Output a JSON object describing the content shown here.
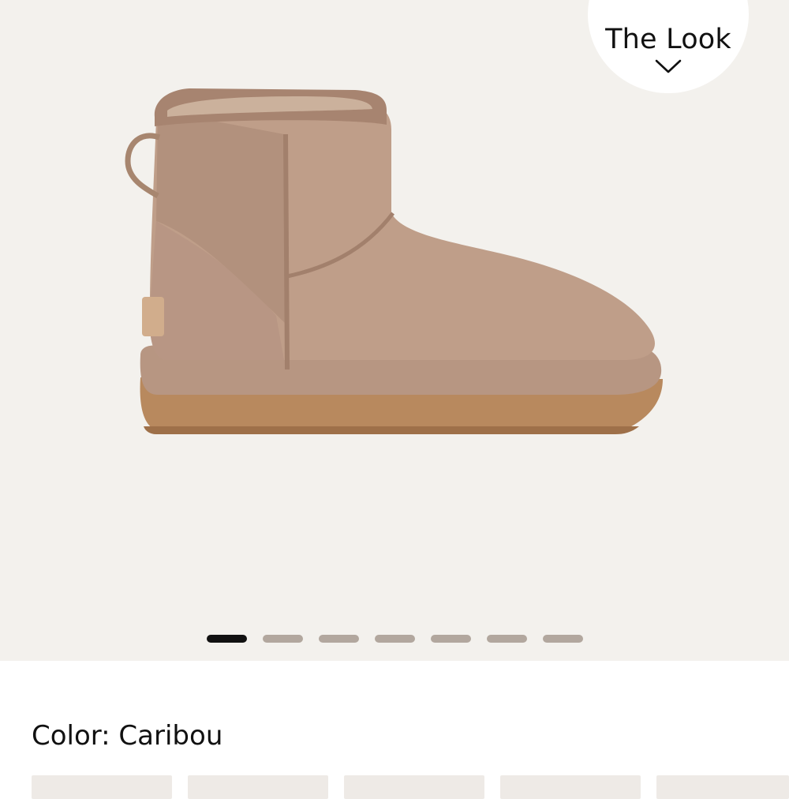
{
  "shop_the_look": {
    "label_top": "p",
    "label": "The Look",
    "icon": "chevron-down-icon"
  },
  "gallery": {
    "image": "ugg-classic-mini-boot-side-view",
    "slide_count": 7,
    "active_slide": 1
  },
  "product": {
    "color_label": "Color: Caribou"
  },
  "colors": {
    "gallery_bg": "#f3f1ed",
    "dot_inactive": "#b2a79e",
    "dot_active": "#111111",
    "swatch_bg": "#eeeae6"
  }
}
